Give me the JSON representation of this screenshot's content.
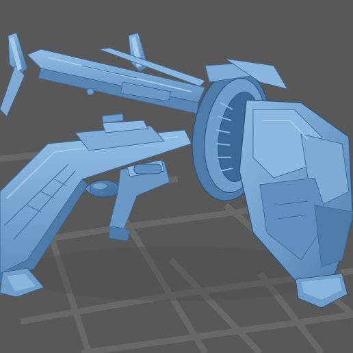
{
  "viewport": {
    "background_color": "#585858",
    "grid_color": "#6a6a6a",
    "model_color": "#6f9ecb",
    "model_shadow_color": "#3f6c98",
    "model_highlight_color": "#a6c9ea"
  }
}
